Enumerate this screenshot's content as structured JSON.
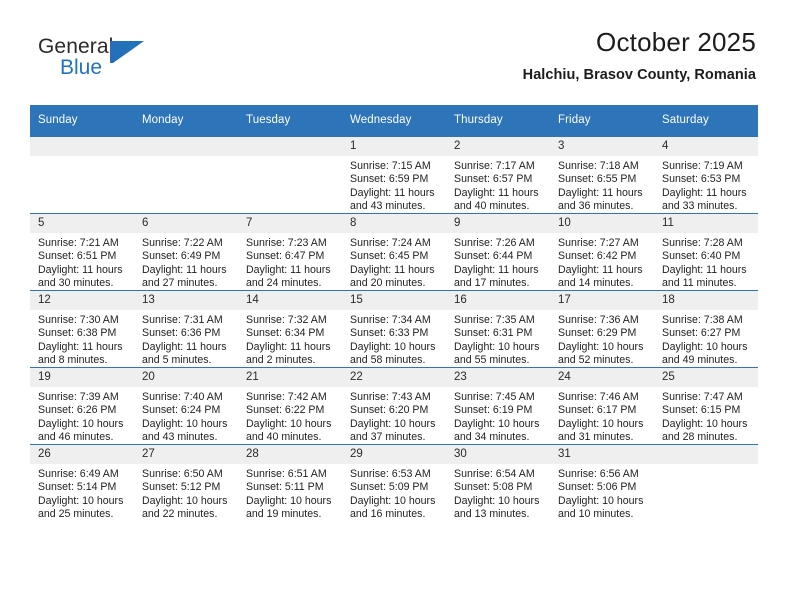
{
  "brand": {
    "name_line1": "General",
    "name_line2": "Blue",
    "logo_icon": "triangle-flag-icon"
  },
  "header": {
    "title": "October 2025",
    "subtitle": "Halchiu, Brasov County, Romania"
  },
  "colors": {
    "header_blue": "#2d74b8",
    "daynum_gray": "#efefef",
    "brand_blue": "#1f73c4",
    "text": "#1f1f1f"
  },
  "calendar": {
    "weekday_headers": [
      "Sunday",
      "Monday",
      "Tuesday",
      "Wednesday",
      "Thursday",
      "Friday",
      "Saturday"
    ],
    "weeks": [
      [
        {
          "day": "",
          "blank": true
        },
        {
          "day": "",
          "blank": true
        },
        {
          "day": "",
          "blank": true
        },
        {
          "day": "1",
          "sunrise": "Sunrise: 7:15 AM",
          "sunset": "Sunset: 6:59 PM",
          "daylight": "Daylight: 11 hours and 43 minutes."
        },
        {
          "day": "2",
          "sunrise": "Sunrise: 7:17 AM",
          "sunset": "Sunset: 6:57 PM",
          "daylight": "Daylight: 11 hours and 40 minutes."
        },
        {
          "day": "3",
          "sunrise": "Sunrise: 7:18 AM",
          "sunset": "Sunset: 6:55 PM",
          "daylight": "Daylight: 11 hours and 36 minutes."
        },
        {
          "day": "4",
          "sunrise": "Sunrise: 7:19 AM",
          "sunset": "Sunset: 6:53 PM",
          "daylight": "Daylight: 11 hours and 33 minutes."
        }
      ],
      [
        {
          "day": "5",
          "sunrise": "Sunrise: 7:21 AM",
          "sunset": "Sunset: 6:51 PM",
          "daylight": "Daylight: 11 hours and 30 minutes."
        },
        {
          "day": "6",
          "sunrise": "Sunrise: 7:22 AM",
          "sunset": "Sunset: 6:49 PM",
          "daylight": "Daylight: 11 hours and 27 minutes."
        },
        {
          "day": "7",
          "sunrise": "Sunrise: 7:23 AM",
          "sunset": "Sunset: 6:47 PM",
          "daylight": "Daylight: 11 hours and 24 minutes."
        },
        {
          "day": "8",
          "sunrise": "Sunrise: 7:24 AM",
          "sunset": "Sunset: 6:45 PM",
          "daylight": "Daylight: 11 hours and 20 minutes."
        },
        {
          "day": "9",
          "sunrise": "Sunrise: 7:26 AM",
          "sunset": "Sunset: 6:44 PM",
          "daylight": "Daylight: 11 hours and 17 minutes."
        },
        {
          "day": "10",
          "sunrise": "Sunrise: 7:27 AM",
          "sunset": "Sunset: 6:42 PM",
          "daylight": "Daylight: 11 hours and 14 minutes."
        },
        {
          "day": "11",
          "sunrise": "Sunrise: 7:28 AM",
          "sunset": "Sunset: 6:40 PM",
          "daylight": "Daylight: 11 hours and 11 minutes."
        }
      ],
      [
        {
          "day": "12",
          "sunrise": "Sunrise: 7:30 AM",
          "sunset": "Sunset: 6:38 PM",
          "daylight": "Daylight: 11 hours and 8 minutes."
        },
        {
          "day": "13",
          "sunrise": "Sunrise: 7:31 AM",
          "sunset": "Sunset: 6:36 PM",
          "daylight": "Daylight: 11 hours and 5 minutes."
        },
        {
          "day": "14",
          "sunrise": "Sunrise: 7:32 AM",
          "sunset": "Sunset: 6:34 PM",
          "daylight": "Daylight: 11 hours and 2 minutes."
        },
        {
          "day": "15",
          "sunrise": "Sunrise: 7:34 AM",
          "sunset": "Sunset: 6:33 PM",
          "daylight": "Daylight: 10 hours and 58 minutes."
        },
        {
          "day": "16",
          "sunrise": "Sunrise: 7:35 AM",
          "sunset": "Sunset: 6:31 PM",
          "daylight": "Daylight: 10 hours and 55 minutes."
        },
        {
          "day": "17",
          "sunrise": "Sunrise: 7:36 AM",
          "sunset": "Sunset: 6:29 PM",
          "daylight": "Daylight: 10 hours and 52 minutes."
        },
        {
          "day": "18",
          "sunrise": "Sunrise: 7:38 AM",
          "sunset": "Sunset: 6:27 PM",
          "daylight": "Daylight: 10 hours and 49 minutes."
        }
      ],
      [
        {
          "day": "19",
          "sunrise": "Sunrise: 7:39 AM",
          "sunset": "Sunset: 6:26 PM",
          "daylight": "Daylight: 10 hours and 46 minutes."
        },
        {
          "day": "20",
          "sunrise": "Sunrise: 7:40 AM",
          "sunset": "Sunset: 6:24 PM",
          "daylight": "Daylight: 10 hours and 43 minutes."
        },
        {
          "day": "21",
          "sunrise": "Sunrise: 7:42 AM",
          "sunset": "Sunset: 6:22 PM",
          "daylight": "Daylight: 10 hours and 40 minutes."
        },
        {
          "day": "22",
          "sunrise": "Sunrise: 7:43 AM",
          "sunset": "Sunset: 6:20 PM",
          "daylight": "Daylight: 10 hours and 37 minutes."
        },
        {
          "day": "23",
          "sunrise": "Sunrise: 7:45 AM",
          "sunset": "Sunset: 6:19 PM",
          "daylight": "Daylight: 10 hours and 34 minutes."
        },
        {
          "day": "24",
          "sunrise": "Sunrise: 7:46 AM",
          "sunset": "Sunset: 6:17 PM",
          "daylight": "Daylight: 10 hours and 31 minutes."
        },
        {
          "day": "25",
          "sunrise": "Sunrise: 7:47 AM",
          "sunset": "Sunset: 6:15 PM",
          "daylight": "Daylight: 10 hours and 28 minutes."
        }
      ],
      [
        {
          "day": "26",
          "sunrise": "Sunrise: 6:49 AM",
          "sunset": "Sunset: 5:14 PM",
          "daylight": "Daylight: 10 hours and 25 minutes."
        },
        {
          "day": "27",
          "sunrise": "Sunrise: 6:50 AM",
          "sunset": "Sunset: 5:12 PM",
          "daylight": "Daylight: 10 hours and 22 minutes."
        },
        {
          "day": "28",
          "sunrise": "Sunrise: 6:51 AM",
          "sunset": "Sunset: 5:11 PM",
          "daylight": "Daylight: 10 hours and 19 minutes."
        },
        {
          "day": "29",
          "sunrise": "Sunrise: 6:53 AM",
          "sunset": "Sunset: 5:09 PM",
          "daylight": "Daylight: 10 hours and 16 minutes."
        },
        {
          "day": "30",
          "sunrise": "Sunrise: 6:54 AM",
          "sunset": "Sunset: 5:08 PM",
          "daylight": "Daylight: 10 hours and 13 minutes."
        },
        {
          "day": "31",
          "sunrise": "Sunrise: 6:56 AM",
          "sunset": "Sunset: 5:06 PM",
          "daylight": "Daylight: 10 hours and 10 minutes."
        },
        {
          "day": "",
          "blank": true
        }
      ]
    ]
  }
}
